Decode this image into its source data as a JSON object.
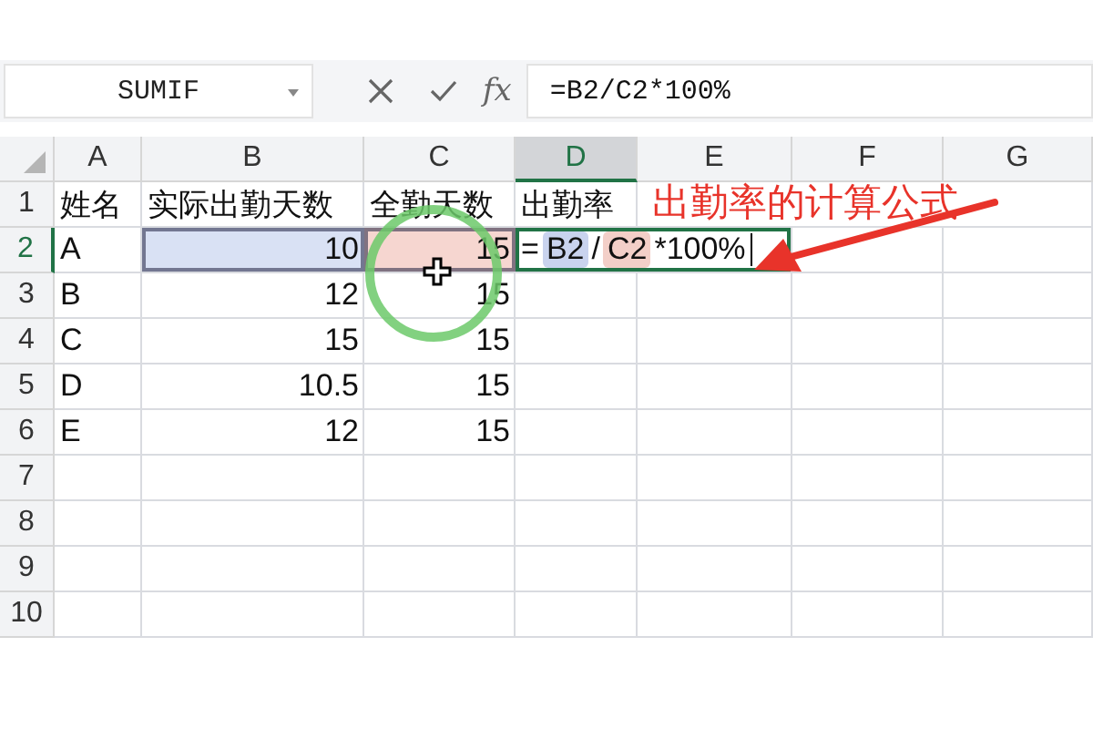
{
  "name_box": {
    "value": "SUMIF"
  },
  "formula_bar": {
    "function_label": "fx",
    "value": "=B2/C2*100%"
  },
  "columns": [
    {
      "label": "A",
      "selected": false
    },
    {
      "label": "B",
      "selected": false
    },
    {
      "label": "C",
      "selected": false
    },
    {
      "label": "D",
      "selected": true
    },
    {
      "label": "E",
      "selected": false
    },
    {
      "label": "F",
      "selected": false
    },
    {
      "label": "G",
      "selected": false
    }
  ],
  "rows": [
    {
      "label": "1",
      "selected": false,
      "cells": [
        {
          "text": "姓名",
          "kind": "text"
        },
        {
          "text": "实际出勤天数",
          "kind": "text"
        },
        {
          "text": "全勤天数",
          "kind": "text"
        },
        {
          "text": "出勤率",
          "kind": "text"
        }
      ]
    },
    {
      "label": "2",
      "selected": true,
      "cells": [
        {
          "text": "A",
          "kind": "text"
        },
        {
          "text": "10",
          "kind": "number",
          "color": "#d9e1f4"
        },
        {
          "text": "15",
          "kind": "number",
          "color": "#f6d6d0"
        },
        {
          "kind": "formula",
          "tokens": [
            {
              "text": "=",
              "kind": "plain"
            },
            {
              "text": "B2",
              "kind": "ref",
              "color": "#c9d3ee"
            },
            {
              "text": "/",
              "kind": "plain"
            },
            {
              "text": "C2",
              "kind": "ref",
              "color": "#f3cfc8"
            },
            {
              "text": "*100%",
              "kind": "plain"
            }
          ]
        }
      ]
    },
    {
      "label": "3",
      "selected": false,
      "cells": [
        {
          "text": "B",
          "kind": "text"
        },
        {
          "text": "12",
          "kind": "number"
        },
        {
          "text": "15",
          "kind": "number"
        }
      ]
    },
    {
      "label": "4",
      "selected": false,
      "cells": [
        {
          "text": "C",
          "kind": "text"
        },
        {
          "text": "15",
          "kind": "number"
        },
        {
          "text": "15",
          "kind": "number"
        }
      ]
    },
    {
      "label": "5",
      "selected": false,
      "cells": [
        {
          "text": "D",
          "kind": "text"
        },
        {
          "text": "10.5",
          "kind": "number"
        },
        {
          "text": "15",
          "kind": "number"
        }
      ]
    },
    {
      "label": "6",
      "selected": false,
      "cells": [
        {
          "text": "E",
          "kind": "text"
        },
        {
          "text": "12",
          "kind": "number"
        },
        {
          "text": "15",
          "kind": "number"
        }
      ]
    },
    {
      "label": "7",
      "selected": false,
      "cells": []
    },
    {
      "label": "8",
      "selected": false,
      "cells": []
    },
    {
      "label": "9",
      "selected": false,
      "cells": []
    },
    {
      "label": "10",
      "selected": false,
      "cells": []
    }
  ],
  "annotation": {
    "text": "出勤率的计算公式"
  }
}
